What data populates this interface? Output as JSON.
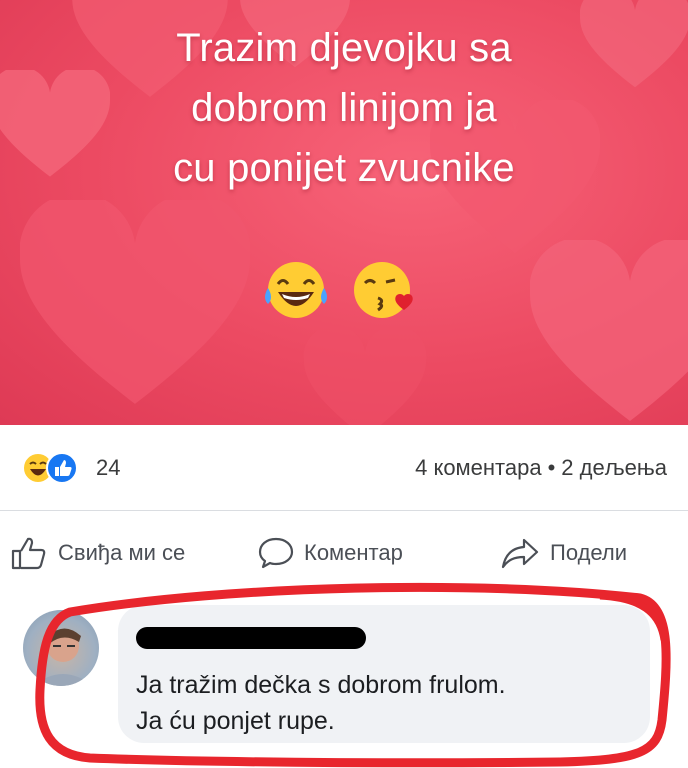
{
  "post": {
    "lines": [
      "Trazim djevojku sa",
      "dobrom linijom ja",
      "cu ponijet zvucnike"
    ],
    "emojis": [
      "laughing-tears-emoji",
      "kissing-heart-emoji"
    ],
    "colors": {
      "background": "#ec4a62",
      "text": "#ffffff",
      "heart": "#f25a70"
    }
  },
  "stats": {
    "reaction_icons": [
      "haha-reaction-icon",
      "like-reaction-icon"
    ],
    "reaction_count": "24",
    "comments": "4 коментара",
    "separator": "•",
    "shares": "2 дељења"
  },
  "actions": {
    "like": {
      "label": "Свиђа ми се",
      "icon": "thumbs-up-icon"
    },
    "comment": {
      "label": "Коментар",
      "icon": "speech-bubble-icon"
    },
    "share": {
      "label": "Подели",
      "icon": "share-arrow-icon"
    }
  },
  "comment": {
    "author": "[redacted]",
    "lines": [
      "Ja tražim dečka s dobrom frulom.",
      "Ja ću ponjet rupe."
    ],
    "highlight_color": "#e8262d"
  }
}
